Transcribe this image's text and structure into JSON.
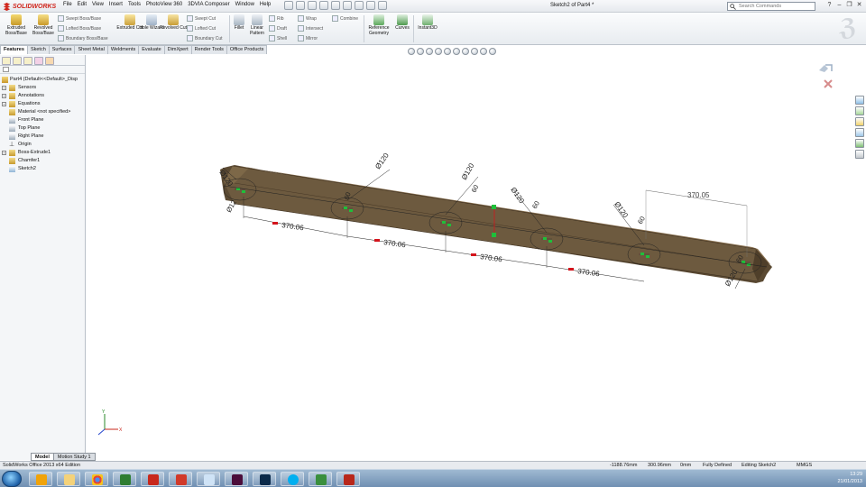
{
  "app": {
    "brand": "SOLIDWORKS",
    "window_title": "Sketch2 of Part4 *",
    "menus": [
      "File",
      "Edit",
      "View",
      "Insert",
      "Tools",
      "PhotoView 360",
      "3DVIA Composer",
      "Window",
      "Help"
    ],
    "search_placeholder": "Search Commands",
    "brand_color": "#d0241a"
  },
  "command_manager": {
    "features": {
      "extruded_boss": "Extruded Boss/Base",
      "revolved_boss": "Revolved Boss/Base",
      "swept_boss": "Swept Boss/Base",
      "lofted_boss": "Lofted Boss/Base",
      "boundary_boss": "Boundary Boss/Base",
      "extruded_cut": "Extruded Cut",
      "hole_wizard": "Hole Wizard",
      "revolved_cut": "Revolved Cut",
      "swept_cut": "Swept Cut",
      "lofted_cut": "Lofted Cut",
      "boundary_cut": "Boundary Cut",
      "fillet": "Fillet",
      "linear_pattern": "Linear Pattern",
      "rib": "Rib",
      "draft": "Draft",
      "shell": "Shell",
      "wrap": "Wrap",
      "intersect": "Intersect",
      "mirror": "Mirror",
      "combine": "Combine",
      "reference_geometry": "Reference Geometry",
      "curves": "Curves",
      "instant3d": "Instant3D"
    },
    "tabs": [
      "Features",
      "Sketch",
      "Surfaces",
      "Sheet Metal",
      "Weldments",
      "Evaluate",
      "DimXpert",
      "Render Tools",
      "Office Products"
    ],
    "active_tab": "Features"
  },
  "feature_tree": {
    "root": "Part4  (Default<<Default>_Disp",
    "items": [
      {
        "label": "Sensors",
        "expandable": true,
        "icon": "sensor-folder-icon"
      },
      {
        "label": "Annotations",
        "expandable": true,
        "icon": "annotations-icon"
      },
      {
        "label": "Equations",
        "expandable": true,
        "icon": "equations-icon"
      },
      {
        "label": "Material <not specified>",
        "expandable": false,
        "icon": "material-icon"
      },
      {
        "label": "Front Plane",
        "expandable": false,
        "icon": "plane-icon"
      },
      {
        "label": "Top Plane",
        "expandable": false,
        "icon": "plane-icon"
      },
      {
        "label": "Right Plane",
        "expandable": false,
        "icon": "plane-icon"
      },
      {
        "label": "Origin",
        "expandable": false,
        "icon": "origin-icon"
      },
      {
        "label": "Boss-Extrude1",
        "expandable": true,
        "icon": "extrude-icon"
      },
      {
        "label": "Chamfer1",
        "expandable": false,
        "icon": "chamfer-icon"
      },
      {
        "label": "Sketch2",
        "expandable": false,
        "icon": "sketch-icon"
      }
    ]
  },
  "model_tabs": [
    "Model",
    "Motion Study 1"
  ],
  "active_model_tab": "Model",
  "status_bar": {
    "product": "SolidWorks Office 2013 x64 Edition",
    "x": "-1188.76mm",
    "y": "300.96mm",
    "z": "0mm",
    "definition": "Fully Defined",
    "mode": "Editing Sketch2",
    "units": "MMGS"
  },
  "taskbar": {
    "time": "13:29",
    "date": "21/01/2013"
  },
  "dimensions": {
    "spacing_linear": [
      "370.06",
      "370.06",
      "370.06",
      "370.06"
    ],
    "spacing_top": "370.05",
    "diameters": [
      "Ø120",
      "Ø120",
      "Ø120",
      "Ø120",
      "Ø120",
      "Ø120"
    ],
    "small_values": [
      "Ø12",
      "60",
      "60",
      "60",
      "60",
      "60"
    ]
  },
  "colors": {
    "beam_top": "#8a7252",
    "beam_front": "#6e5a3e",
    "beam_end": "#5e4c33",
    "sketch_green": "#1fbf3a",
    "dim_red": "#d4141c",
    "dim_line": "#222222"
  }
}
